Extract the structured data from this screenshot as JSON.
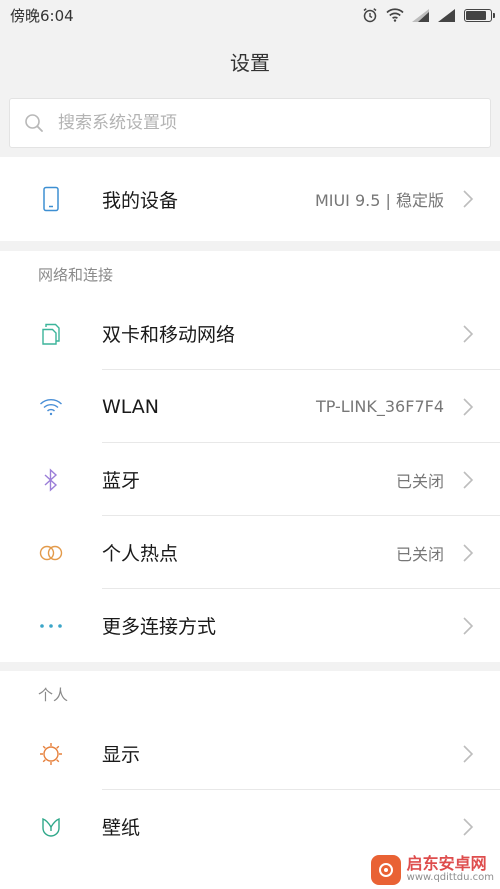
{
  "status_bar": {
    "time": "傍晚6:04",
    "battery_level": 0.85
  },
  "header": {
    "title": "设置"
  },
  "search": {
    "placeholder": "搜索系统设置项"
  },
  "device_row": {
    "label": "我的设备",
    "value": "MIUI 9.5 | 稳定版",
    "icon": "phone-icon"
  },
  "sections": [
    {
      "title": "网络和连接",
      "items": [
        {
          "label": "双卡和移动网络",
          "value": "",
          "icon": "dual-sim-icon",
          "color": "#3bb49a"
        },
        {
          "label": "WLAN",
          "value": "TP-LINK_36F7F4",
          "icon": "wifi-icon",
          "color": "#4a8fd6"
        },
        {
          "label": "蓝牙",
          "value": "已关闭",
          "icon": "bluetooth-icon",
          "color": "#9b7ed8"
        },
        {
          "label": "个人热点",
          "value": "已关闭",
          "icon": "hotspot-icon",
          "color": "#e39a4a"
        },
        {
          "label": "更多连接方式",
          "value": "",
          "icon": "more-dots-icon",
          "color": "#3ba5c8"
        }
      ]
    },
    {
      "title": "个人",
      "items": [
        {
          "label": "显示",
          "value": "",
          "icon": "display-brightness-icon",
          "color": "#e6803c"
        },
        {
          "label": "壁纸",
          "value": "",
          "icon": "wallpaper-icon",
          "color": "#2fa88a"
        }
      ]
    }
  ],
  "watermark": {
    "name": "启东安卓网",
    "url": "www.qdittdu.com"
  }
}
